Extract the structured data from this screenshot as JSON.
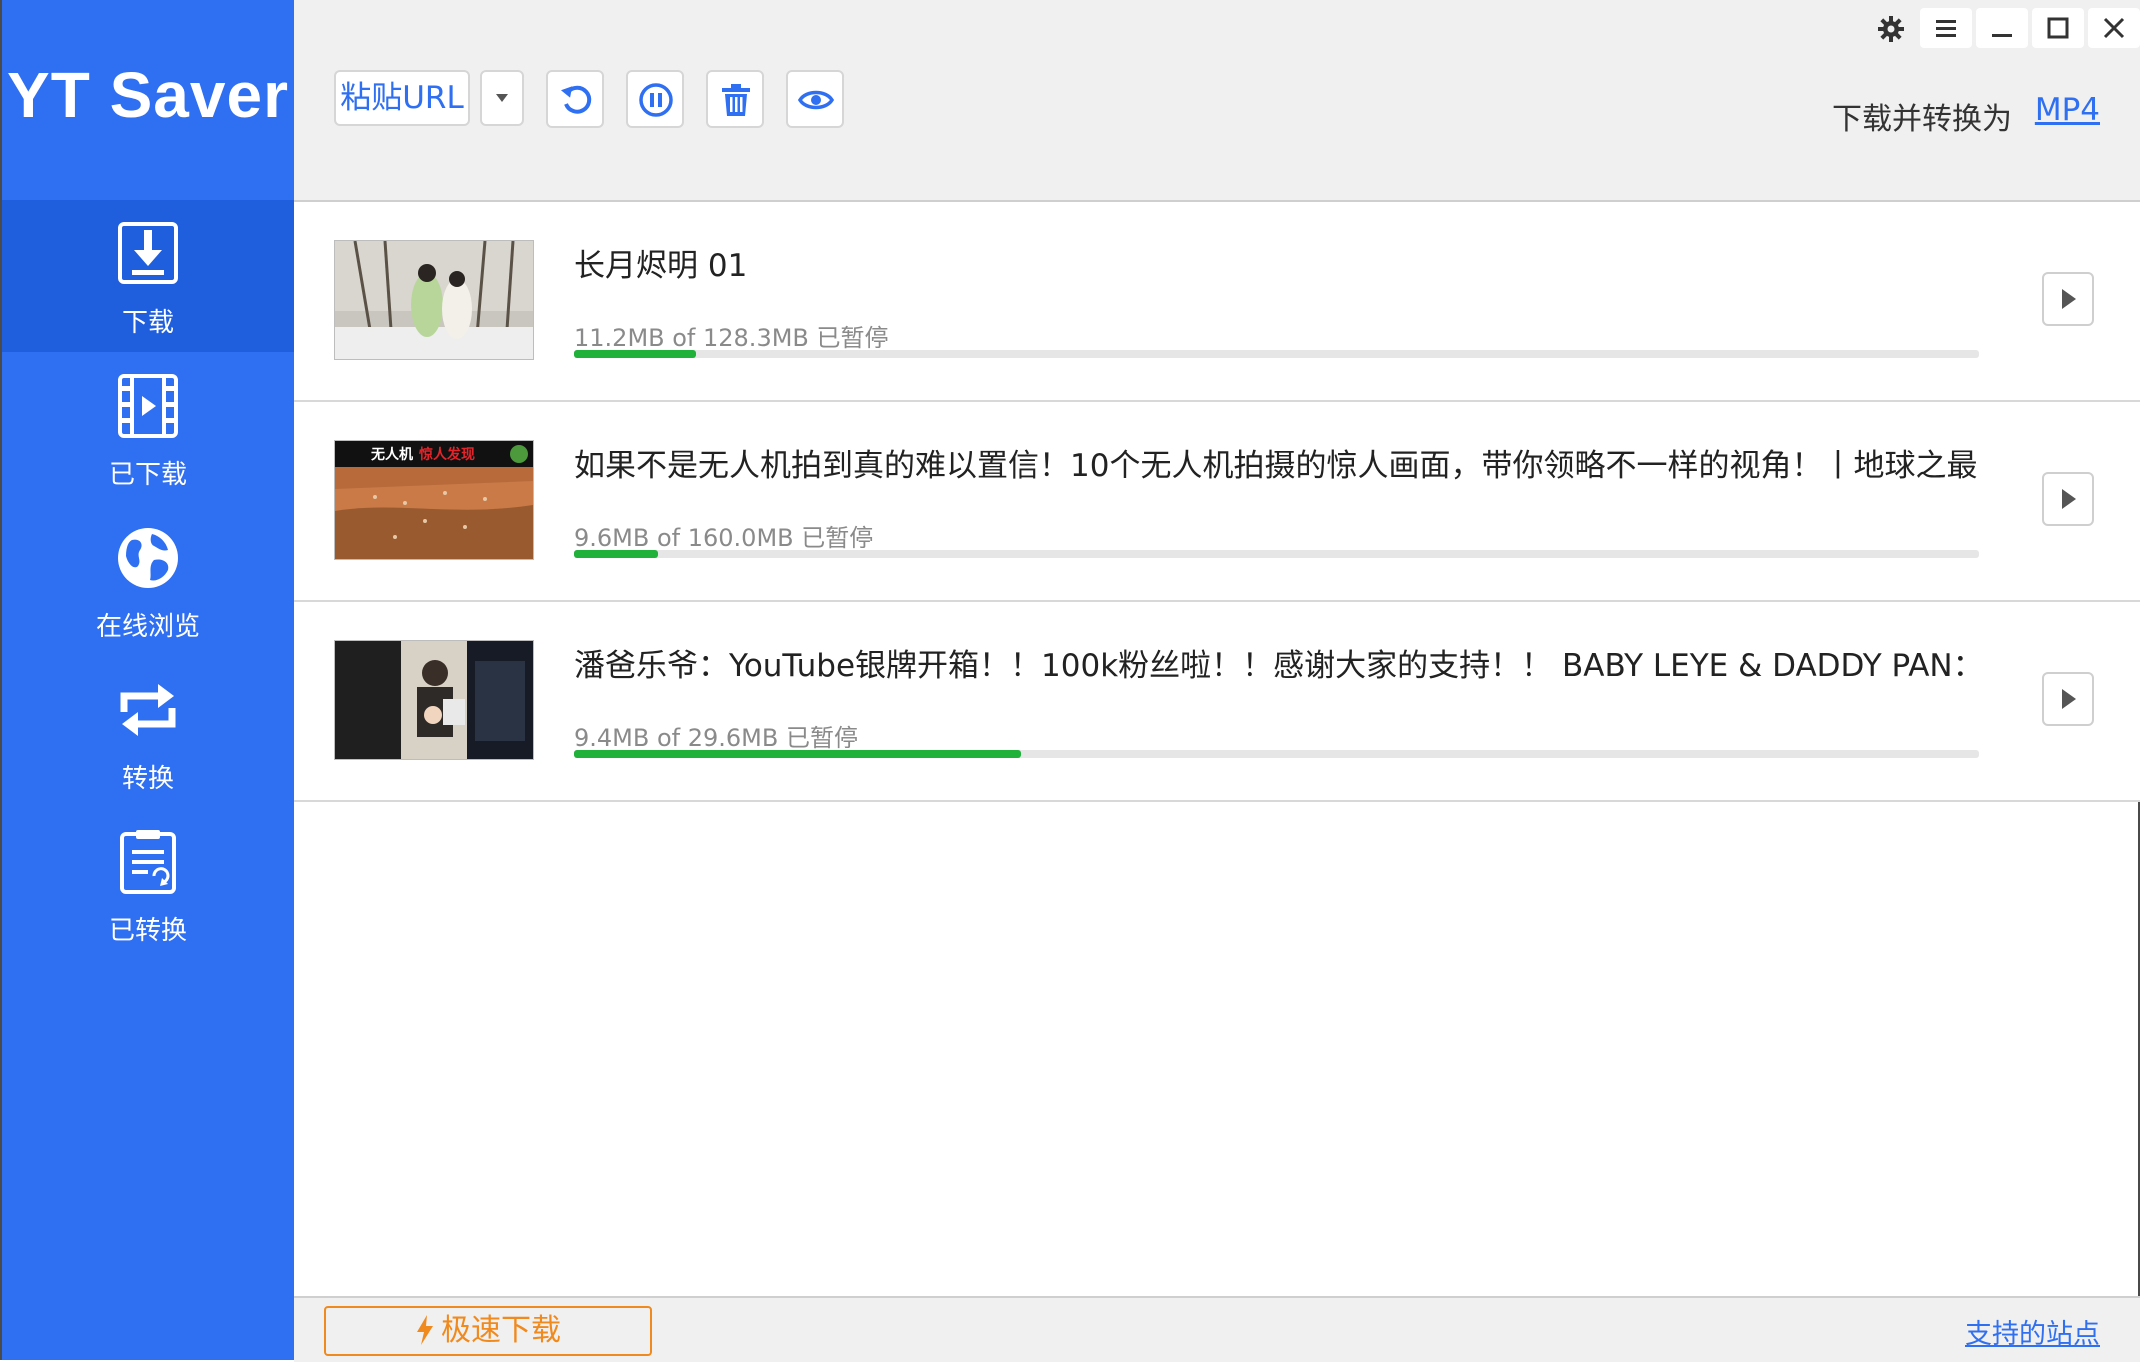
{
  "app": {
    "title": "YT Saver"
  },
  "sidebar": {
    "items": [
      {
        "label": "下载",
        "icon": "download-icon",
        "active": true
      },
      {
        "label": "已下载",
        "icon": "video-film-icon",
        "active": false
      },
      {
        "label": "在线浏览",
        "icon": "globe-icon",
        "active": false
      },
      {
        "label": "转换",
        "icon": "convert-arrows-icon",
        "active": false
      },
      {
        "label": "已转换",
        "icon": "converted-doc-icon",
        "active": false
      }
    ]
  },
  "toolbar": {
    "paste_label": "粘贴URL",
    "icons": [
      "chevron-down-icon",
      "refresh-icon",
      "pause-icon",
      "trash-icon",
      "eye-icon"
    ],
    "convert_label": "下载并转换为",
    "convert_format": "MP4",
    "window_controls": [
      "gear-icon",
      "menu-icon",
      "minimize-icon",
      "maximize-icon",
      "close-icon"
    ]
  },
  "downloads": [
    {
      "title": "长月烬明 01",
      "status": "11.2MB of 128.3MB  已暂停",
      "progress": 0.087
    },
    {
      "title": "如果不是无人机拍到真的难以置信！10个无人机拍摄的惊人画面，带你领略不一样的视角！丨地球之最#冷",
      "status": "9.6MB of 160.0MB  已暂停",
      "progress": 0.06,
      "thumb_caption_white": "无人机",
      "thumb_caption_red": "惊人发现"
    },
    {
      "title": "潘爸乐爷：YouTube银牌开箱！！100k粉丝啦！！感谢大家的支持！！ BABY LEYE & DADDY PAN：YOU",
      "status": "9.4MB of 29.6MB  已暂停",
      "progress": 0.318
    }
  ],
  "footer": {
    "fast_download_label": "极速下载",
    "supported_sites_label": "支持的站点"
  },
  "colors": {
    "sidebar": "#2f6ff2",
    "sidebar_active": "#1f5fde",
    "progress": "#1fb13a",
    "accent_orange": "#f08a1e"
  }
}
